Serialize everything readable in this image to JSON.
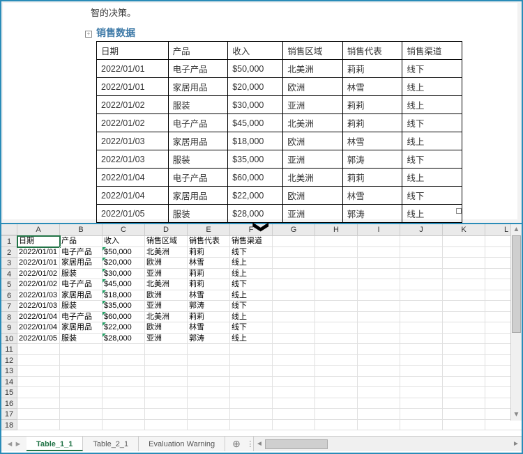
{
  "doc": {
    "intro_fragment": "智的决策。",
    "title": "销售数据",
    "expander_symbol": "+",
    "headers": [
      "日期",
      "产品",
      "收入",
      "销售区域",
      "销售代表",
      "销售渠道"
    ],
    "rows": [
      [
        "2022/01/01",
        "电子产品",
        "$50,000",
        "北美洲",
        "莉莉",
        "线下"
      ],
      [
        "2022/01/01",
        "家居用品",
        "$20,000",
        "欧洲",
        "林雪",
        "线上"
      ],
      [
        "2022/01/02",
        "服装",
        "$30,000",
        "亚洲",
        "莉莉",
        "线上"
      ],
      [
        "2022/01/02",
        "电子产品",
        "$45,000",
        "北美洲",
        "莉莉",
        "线下"
      ],
      [
        "2022/01/03",
        "家居用品",
        "$18,000",
        "欧洲",
        "林雪",
        "线上"
      ],
      [
        "2022/01/03",
        "服装",
        "$35,000",
        "亚洲",
        "郭涛",
        "线下"
      ],
      [
        "2022/01/04",
        "电子产品",
        "$60,000",
        "北美洲",
        "莉莉",
        "线上"
      ],
      [
        "2022/01/04",
        "家居用品",
        "$22,000",
        "欧洲",
        "林雪",
        "线下"
      ],
      [
        "2022/01/05",
        "服装",
        "$28,000",
        "亚洲",
        "郭涛",
        "线上"
      ]
    ]
  },
  "chevron": "❯",
  "sheet": {
    "columns": [
      "A",
      "B",
      "C",
      "D",
      "E",
      "F",
      "G",
      "H",
      "I",
      "J",
      "K",
      "L"
    ],
    "headers": [
      "日期",
      "产品",
      "收入",
      "销售区域",
      "销售代表",
      "销售渠道"
    ],
    "rows": [
      [
        "2022/01/01",
        "电子产品",
        "$50,000",
        "北美洲",
        "莉莉",
        "线下"
      ],
      [
        "2022/01/01",
        "家居用品",
        "$20,000",
        "欧洲",
        "林雪",
        "线上"
      ],
      [
        "2022/01/02",
        "服装",
        "$30,000",
        "亚洲",
        "莉莉",
        "线上"
      ],
      [
        "2022/01/02",
        "电子产品",
        "$45,000",
        "北美洲",
        "莉莉",
        "线下"
      ],
      [
        "2022/01/03",
        "家居用品",
        "$18,000",
        "欧洲",
        "林雪",
        "线上"
      ],
      [
        "2022/01/03",
        "服装",
        "$35,000",
        "亚洲",
        "郭涛",
        "线下"
      ],
      [
        "2022/01/04",
        "电子产品",
        "$60,000",
        "北美洲",
        "莉莉",
        "线上"
      ],
      [
        "2022/01/04",
        "家居用品",
        "$22,000",
        "欧洲",
        "林雪",
        "线下"
      ],
      [
        "2022/01/05",
        "服装",
        "$28,000",
        "亚洲",
        "郭涛",
        "线上"
      ]
    ],
    "total_visible_rows": 18,
    "selected_cell": "A1",
    "text_indicator_col_index": 2,
    "tabs": {
      "active": "Table_1_1",
      "items": [
        "Table_1_1",
        "Table_2_1",
        "Evaluation Warning"
      ],
      "add_symbol": "⊕",
      "sep_symbol": "⋮",
      "nav_left": "◄",
      "nav_right": "►"
    },
    "scroll_arrows": {
      "left": "◄",
      "right": "►",
      "up": "▲",
      "down": "▼"
    }
  }
}
